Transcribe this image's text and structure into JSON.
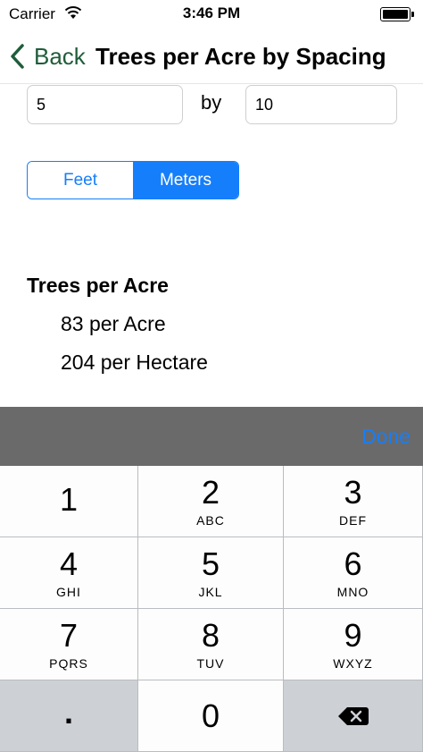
{
  "status_bar": {
    "carrier": "Carrier",
    "time": "3:46 PM",
    "icons": [
      "wifi-icon",
      "battery-icon"
    ]
  },
  "nav": {
    "back_label": "Back",
    "title": "Trees per Acre by Spacing",
    "back_color": "#1f5d3a"
  },
  "spacing": {
    "value_1": "5",
    "separator": "by",
    "value_2": "10"
  },
  "units": {
    "options": [
      "Feet",
      "Meters"
    ],
    "selected": "Meters",
    "accent": "#157efb"
  },
  "results": {
    "heading": "Trees per Acre",
    "per_acre": "83 per Acre",
    "per_hectare": "204 per Hectare"
  },
  "keyboard": {
    "done_label": "Done",
    "keys": [
      {
        "num": "1",
        "letters": ""
      },
      {
        "num": "2",
        "letters": "ABC"
      },
      {
        "num": "3",
        "letters": "DEF"
      },
      {
        "num": "4",
        "letters": "GHI"
      },
      {
        "num": "5",
        "letters": "JKL"
      },
      {
        "num": "6",
        "letters": "MNO"
      },
      {
        "num": "7",
        "letters": "PQRS"
      },
      {
        "num": "8",
        "letters": "TUV"
      },
      {
        "num": "9",
        "letters": "WXYZ"
      }
    ],
    "decimal": ".",
    "zero": "0",
    "delete_icon": "backspace-icon"
  }
}
